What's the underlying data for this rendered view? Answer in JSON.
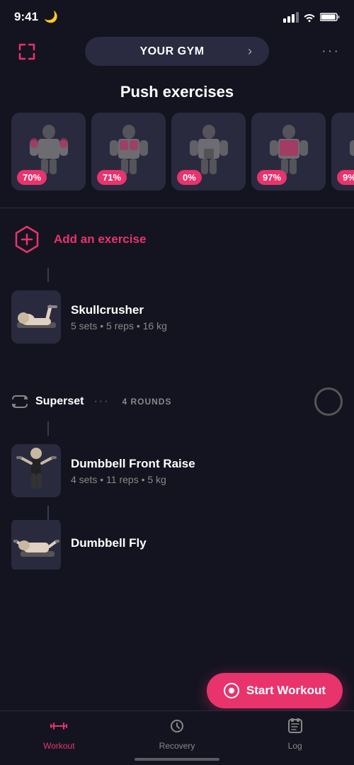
{
  "statusBar": {
    "time": "9:41",
    "moonIcon": "🌙"
  },
  "header": {
    "gymButton": {
      "label": "YOUR GYM",
      "chevron": "›"
    },
    "moreDots": "···"
  },
  "section": {
    "title": "Push exercises"
  },
  "muscleCards": [
    {
      "percent": "70%",
      "isZero": false
    },
    {
      "percent": "71%",
      "isZero": false
    },
    {
      "percent": "0%",
      "isZero": true
    },
    {
      "percent": "97%",
      "isZero": false
    },
    {
      "percent": "9%",
      "isZero": false
    }
  ],
  "addExercise": {
    "label": "Add an exercise"
  },
  "exercises": [
    {
      "name": "Skullcrusher",
      "details": "5 sets • 5 reps • 16 kg"
    }
  ],
  "superset": {
    "label": "Superset",
    "dots": "···",
    "rounds": "4 ROUNDS"
  },
  "supersetExercises": [
    {
      "name": "Dumbbell Front Raise",
      "details": "4 sets • 11 reps • 5 kg"
    },
    {
      "name": "Dumbbell Fly",
      "details": ""
    }
  ],
  "startWorkout": {
    "label": "Start Workout"
  },
  "bottomNav": [
    {
      "label": "Workout",
      "active": true
    },
    {
      "label": "Recovery",
      "active": false
    },
    {
      "label": "Log",
      "active": false
    }
  ]
}
